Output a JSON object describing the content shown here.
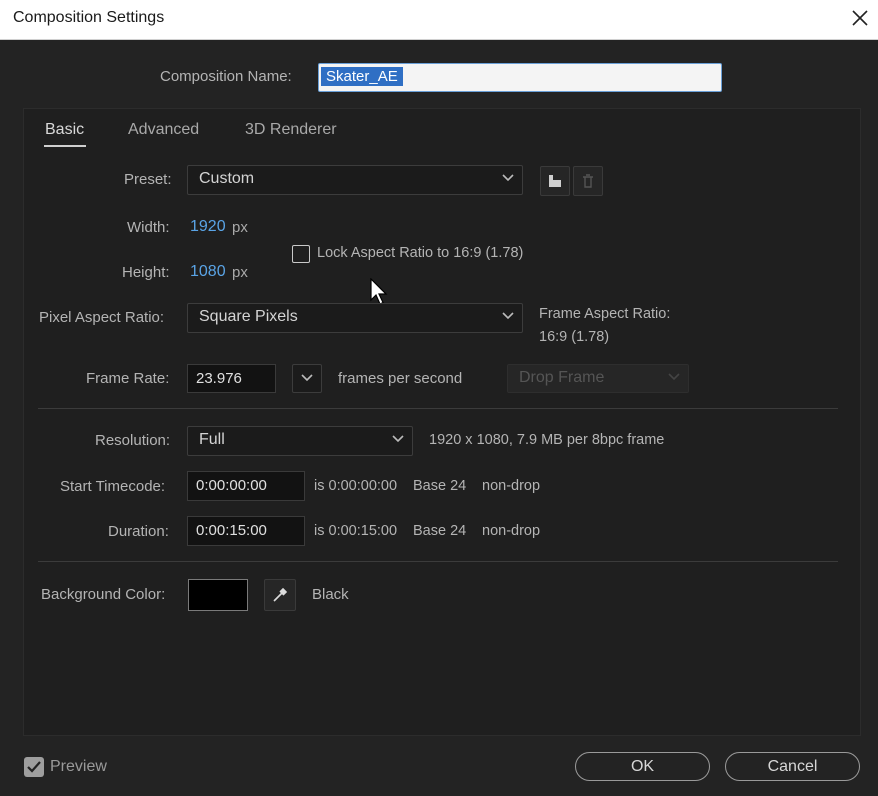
{
  "window": {
    "title": "Composition Settings"
  },
  "composition_name": {
    "label": "Composition Name:",
    "value": "Skater_AE"
  },
  "tabs": [
    {
      "label": "Basic"
    },
    {
      "label": "Advanced"
    },
    {
      "label": "3D Renderer"
    }
  ],
  "preset": {
    "label": "Preset:",
    "value": "Custom"
  },
  "width": {
    "label": "Width:",
    "value": "1920",
    "unit": "px"
  },
  "height": {
    "label": "Height:",
    "value": "1080",
    "unit": "px"
  },
  "lock_aspect": {
    "label": "Lock Aspect Ratio to 16:9 (1.78)",
    "checked": false
  },
  "pixel_aspect": {
    "label": "Pixel Aspect Ratio:",
    "value": "Square Pixels"
  },
  "frame_aspect": {
    "label": "Frame Aspect Ratio:",
    "value": "16:9 (1.78)"
  },
  "frame_rate": {
    "label": "Frame Rate:",
    "value": "23.976",
    "unit": "frames per second",
    "drop_frame": "Drop Frame"
  },
  "resolution": {
    "label": "Resolution:",
    "value": "Full",
    "info": "1920 x 1080, 7.9 MB per 8bpc frame"
  },
  "start_timecode": {
    "label": "Start Timecode:",
    "value": "0:00:00:00",
    "is": "is 0:00:00:00",
    "base": "Base 24",
    "mode": "non-drop"
  },
  "duration": {
    "label": "Duration:",
    "value": "0:00:15:00",
    "is": "is 0:00:15:00",
    "base": "Base 24",
    "mode": "non-drop"
  },
  "background": {
    "label": "Background Color:",
    "color": "#000000",
    "name": "Black"
  },
  "footer": {
    "preview_label": "Preview",
    "preview_checked": true,
    "ok_label": "OK",
    "cancel_label": "Cancel"
  }
}
